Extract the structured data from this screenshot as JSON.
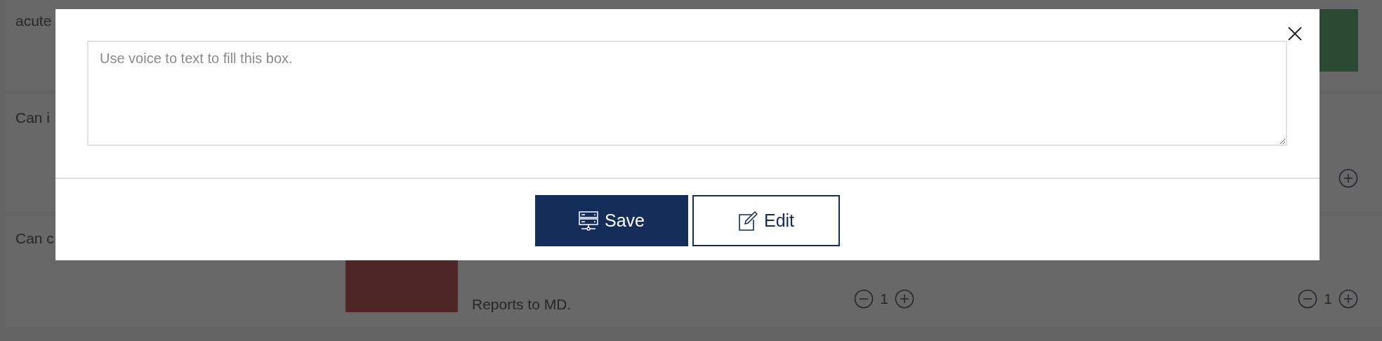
{
  "page_rows": [
    {
      "label": [
        "acute"
      ],
      "end": {
        "kind": "block",
        "color": "#2b4a33"
      }
    },
    {
      "label": [
        "Can i"
      ],
      "end": {
        "kind": "plus"
      }
    },
    {
      "label": [
        "Can c"
      ],
      "block": {
        "color": "#4e2626"
      },
      "detail": [
        "Reports to MD."
      ],
      "counter": {
        "value": "1"
      },
      "end": {
        "kind": "counter",
        "value": "1"
      }
    }
  ],
  "dialog": {
    "textarea": {
      "placeholder": "Use voice to text to fill this box."
    },
    "buttons": [
      {
        "kind": "save",
        "label": "Save"
      },
      {
        "kind": "edit",
        "label": "Edit"
      }
    ]
  }
}
